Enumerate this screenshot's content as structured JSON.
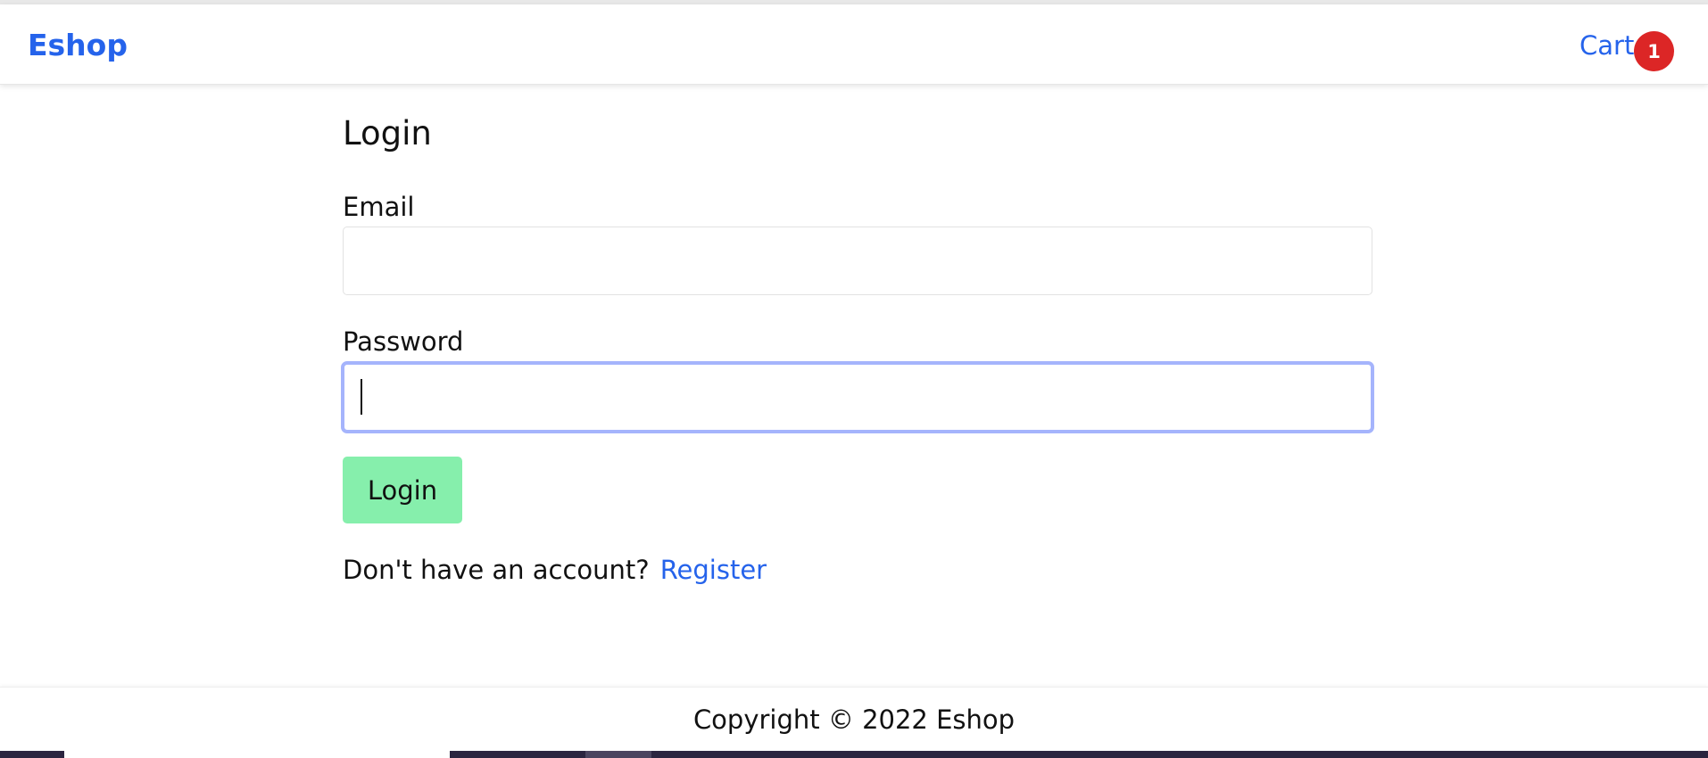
{
  "navbar": {
    "brand": "Eshop",
    "cart_label": "Cart",
    "cart_count": "1"
  },
  "login": {
    "title": "Login",
    "email_label": "Email",
    "email_value": "",
    "password_label": "Password",
    "password_value": "",
    "submit_label": "Login",
    "register_prompt": "Don't have an account?",
    "register_link": "Register"
  },
  "footer": {
    "copyright": "Copyright © 2022 Eshop"
  },
  "colors": {
    "brand": "#2563eb",
    "badge": "#dc2626",
    "login_button": "#86efac",
    "focus_ring": "#a5b4fc"
  }
}
